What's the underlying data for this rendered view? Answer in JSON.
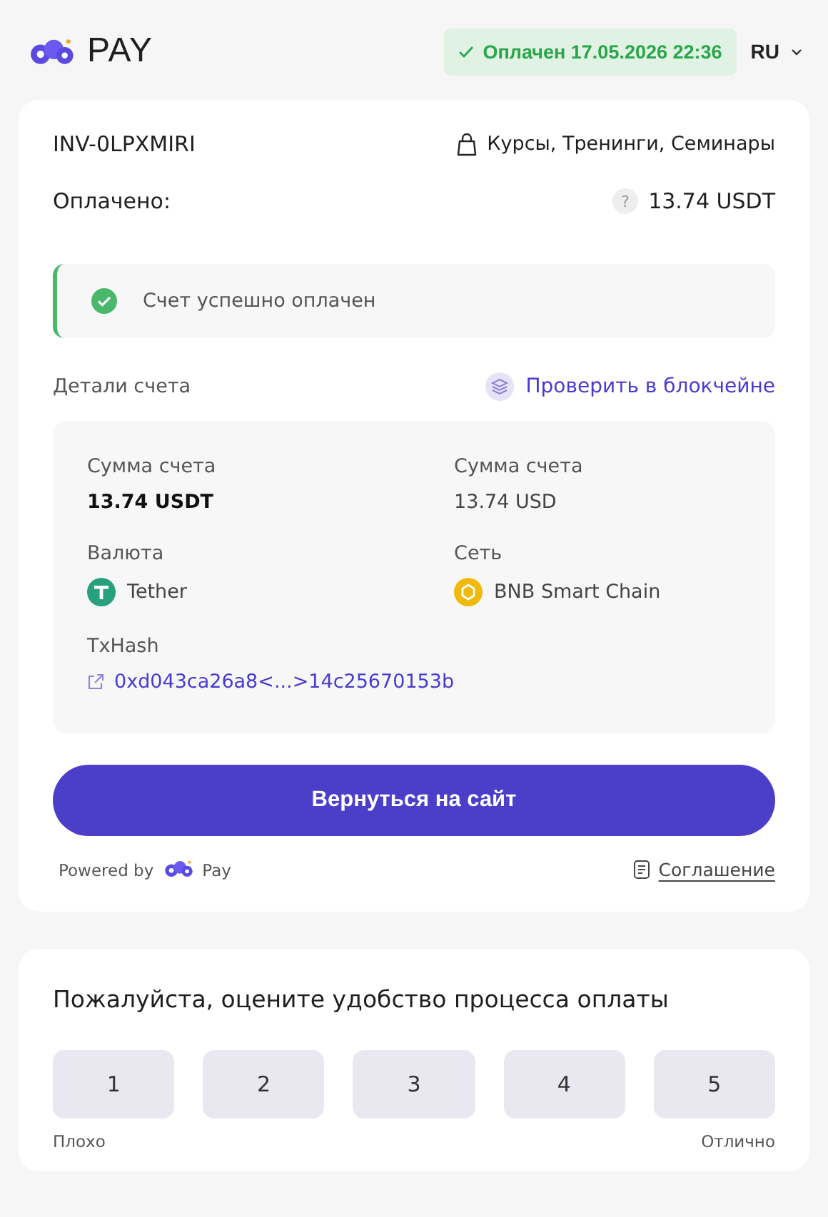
{
  "header": {
    "brand": "PAY",
    "status": {
      "kind": "paid",
      "label": "Оплачен 17.05.2026 22:36"
    },
    "language": "RU"
  },
  "invoice": {
    "id": "INV-0LPXMIRI",
    "category": "Курсы, Тренинги, Семинары",
    "paid_label": "Оплачено:",
    "paid_help": "?",
    "paid_amount": "13.74 USDT"
  },
  "alert": {
    "kind": "success",
    "message": "Счет успешно оплачен"
  },
  "details": {
    "title": "Детали счета",
    "verify_link": "Проверить в блокчейне",
    "fields": [
      {
        "label": "Сумма счета",
        "value": "13.74 USDT",
        "kind": "primary"
      },
      {
        "label": "Сумма счета",
        "value": "13.74 USD",
        "kind": "plain"
      },
      {
        "label": "Валюта",
        "value": "Tether",
        "kind": "asset"
      },
      {
        "label": "Сеть",
        "value": "BNB Smart Chain",
        "kind": "network"
      },
      {
        "label": "TxHash",
        "value": "0xd043ca26a8<...>14c25670153b",
        "kind": "link"
      }
    ]
  },
  "return_button": "Вернуться на сайт",
  "footer": {
    "powered_by": "Powered by",
    "powered_brand": "Pay",
    "agreement": "Соглашение"
  },
  "rating": {
    "question": "Пожалуйста, оцените удобство процесса оплаты",
    "options": [
      {
        "label": "1",
        "selected": false
      },
      {
        "label": "2",
        "selected": false
      },
      {
        "label": "3",
        "selected": false
      },
      {
        "label": "4",
        "selected": false
      },
      {
        "label": "5",
        "selected": false
      }
    ],
    "low_label": "Плохо",
    "high_label": "Отлично"
  }
}
